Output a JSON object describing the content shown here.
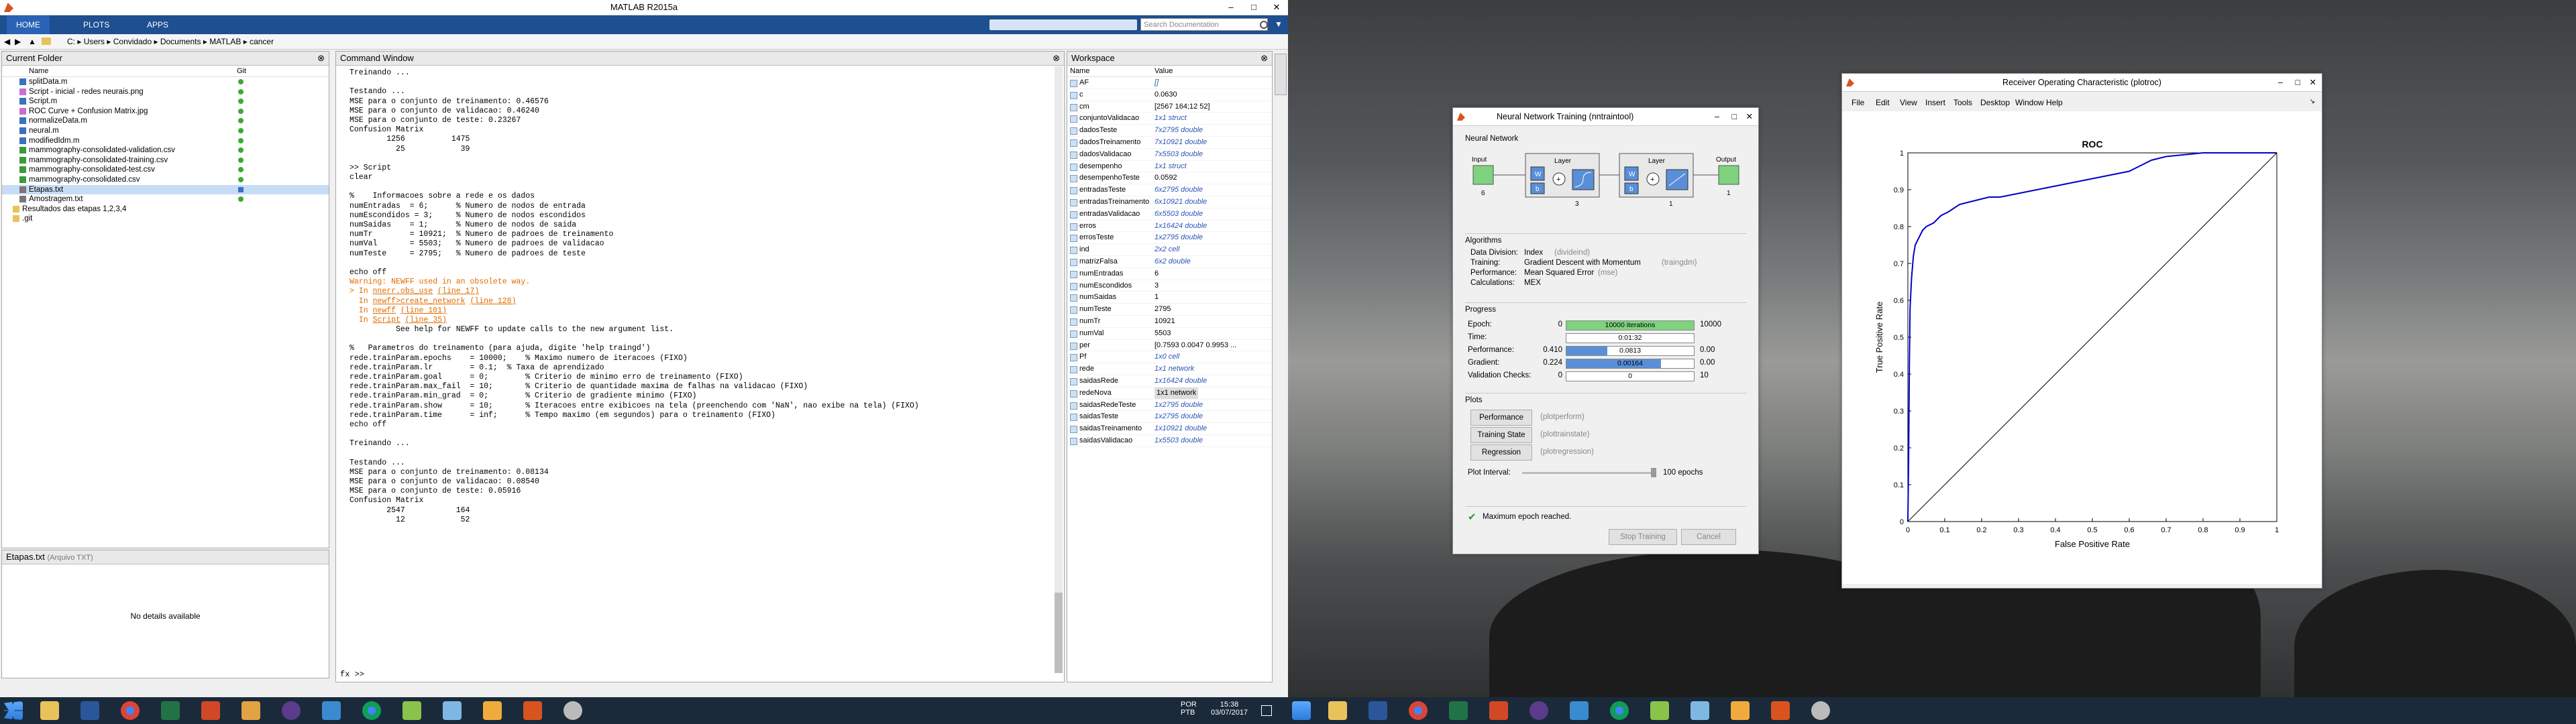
{
  "matlab": {
    "title": "MATLAB R2015a",
    "tabs": [
      "HOME",
      "PLOTS",
      "APPS"
    ],
    "search_placeholder": "Search Documentation",
    "path": [
      "C:",
      "Users",
      "Convidado",
      "Documents",
      "MATLAB",
      "cancer"
    ],
    "current_folder": {
      "title": "Current Folder",
      "col_name": "Name",
      "col_git": "Git",
      "files": [
        {
          "name": "splitData.m",
          "type": "m"
        },
        {
          "name": "Script - inicial - redes neurais.png",
          "type": "png"
        },
        {
          "name": "Script.m",
          "type": "m"
        },
        {
          "name": "ROC Curve + Confusion Matrix.jpg",
          "type": "img"
        },
        {
          "name": "normalizeData.m",
          "type": "m"
        },
        {
          "name": "neural.m",
          "type": "m"
        },
        {
          "name": "modifiedIdm.m",
          "type": "m"
        },
        {
          "name": "mammography-consolidated-validation.csv",
          "type": "csv"
        },
        {
          "name": "mammography-consolidated-training.csv",
          "type": "csv"
        },
        {
          "name": "mammography-consolidated-test.csv",
          "type": "csv"
        },
        {
          "name": "mammography-consolidated.csv",
          "type": "csv"
        },
        {
          "name": "Etapas.txt",
          "type": "txt"
        },
        {
          "name": "Amostragem.txt",
          "type": "txt"
        },
        {
          "name": "Resultados das etapas 1,2,3,4",
          "type": "folder"
        },
        {
          "name": ".git",
          "type": "folder"
        }
      ],
      "details_title": "Etapas.txt",
      "details_subtitle": "(Arquivo TXT)",
      "details_text": "No details available"
    },
    "command_window": {
      "title": "Command Window",
      "prompt": "fx >>",
      "lines": [
        {
          "t": "Treinando ...",
          "c": "n"
        },
        {
          "t": "",
          "c": "n"
        },
        {
          "t": "Testando ...",
          "c": "n"
        },
        {
          "t": "MSE para o conjunto de treinamento: 0.46576",
          "c": "n"
        },
        {
          "t": "MSE para o conjunto de validacao: 0.46240",
          "c": "n"
        },
        {
          "t": "MSE para o conjunto de teste: 0.23267",
          "c": "n"
        },
        {
          "t": "Confusion Matrix",
          "c": "n"
        },
        {
          "t": "        1256          1475",
          "c": "n"
        },
        {
          "t": "          25            39",
          "c": "n"
        },
        {
          "t": "",
          "c": "n"
        },
        {
          "t": ">> Script",
          "c": "n"
        },
        {
          "t": "clear",
          "c": "n"
        },
        {
          "t": "",
          "c": "n"
        },
        {
          "t": "%    Informacoes sobre a rede e os dados",
          "c": "n"
        },
        {
          "t": "numEntradas  = 6;      % Numero de nodos de entrada",
          "c": "n"
        },
        {
          "t": "numEscondidos = 3;     % Numero de nodos escondidos",
          "c": "n"
        },
        {
          "t": "numSaidas    = 1;      % Numero de nodos de saida",
          "c": "n"
        },
        {
          "t": "numTr        = 10921;  % Numero de padroes de treinamento",
          "c": "n"
        },
        {
          "t": "numVal       = 5503;   % Numero de padroes de validacao",
          "c": "n"
        },
        {
          "t": "numTeste     = 2795;   % Numero de padroes de teste",
          "c": "n"
        },
        {
          "t": "",
          "c": "n"
        },
        {
          "t": "echo off",
          "c": "n"
        },
        {
          "t": "Warning: NEWFF used in an obsolete way.",
          "c": "w"
        },
        {
          "t": "> In ",
          "c": "w",
          "l1": "nnerr.obs_use",
          "l2": "(line 17)"
        },
        {
          "t": "  In ",
          "c": "w",
          "l1": "newff>create_network",
          "l2": "(line 128)"
        },
        {
          "t": "  In ",
          "c": "w",
          "l1": "newff",
          "l2": "(line 101)"
        },
        {
          "t": "  In ",
          "c": "w",
          "l1": "Script",
          "l2": "(line 35)"
        },
        {
          "t": "          See help for NEWFF to update calls to the new argument list.",
          "c": "n"
        },
        {
          "t": "",
          "c": "n"
        },
        {
          "t": "%   Parametros do treinamento (para ajuda, digite 'help traingd')",
          "c": "n"
        },
        {
          "t": "rede.trainParam.epochs    = 10000;    % Maximo numero de iteracoes (FIXO)",
          "c": "n"
        },
        {
          "t": "rede.trainParam.lr        = 0.1;  % Taxa de aprendizado",
          "c": "n"
        },
        {
          "t": "rede.trainParam.goal      = 0;        % Criterio de minimo erro de treinamento (FIXO)",
          "c": "n"
        },
        {
          "t": "rede.trainParam.max_fail  = 10;       % Criterio de quantidade maxima de falhas na validacao (FIXO)",
          "c": "n"
        },
        {
          "t": "rede.trainParam.min_grad  = 0;        % Criterio de gradiente minimo (FIXO)",
          "c": "n"
        },
        {
          "t": "rede.trainParam.show      = 10;       % Iteracoes entre exibicoes na tela (preenchendo com 'NaN', nao exibe na tela) (FIXO)",
          "c": "n"
        },
        {
          "t": "rede.trainParam.time      = inf;      % Tempo maximo (em segundos) para o treinamento (FIXO)",
          "c": "n"
        },
        {
          "t": "echo off",
          "c": "n"
        },
        {
          "t": "",
          "c": "n"
        },
        {
          "t": "Treinando ...",
          "c": "n"
        },
        {
          "t": "",
          "c": "n"
        },
        {
          "t": "Testando ...",
          "c": "n"
        },
        {
          "t": "MSE para o conjunto de treinamento: 0.08134",
          "c": "n"
        },
        {
          "t": "MSE para o conjunto de validacao: 0.08540",
          "c": "n"
        },
        {
          "t": "MSE para o conjunto de teste: 0.05916",
          "c": "n"
        },
        {
          "t": "Confusion Matrix",
          "c": "n"
        },
        {
          "t": "        2547           164",
          "c": "n"
        },
        {
          "t": "          12            52",
          "c": "n"
        }
      ]
    },
    "workspace": {
      "title": "Workspace",
      "col_name": "Name",
      "col_value": "Value",
      "vars": [
        {
          "n": "AF",
          "v": "[]",
          "b": true
        },
        {
          "n": "c",
          "v": "0.0630",
          "b": false
        },
        {
          "n": "cm",
          "v": "[2567 164;12 52]",
          "b": false
        },
        {
          "n": "conjuntoValidacao",
          "v": "1x1 struct",
          "b": true
        },
        {
          "n": "dadosTeste",
          "v": "7x2795 double",
          "b": true
        },
        {
          "n": "dadosTreinamento",
          "v": "7x10921 double",
          "b": true
        },
        {
          "n": "dadosValidacao",
          "v": "7x5503 double",
          "b": true
        },
        {
          "n": "desempenho",
          "v": "1x1 struct",
          "b": true
        },
        {
          "n": "desempenhoTeste",
          "v": "0.0592",
          "b": false
        },
        {
          "n": "entradasTeste",
          "v": "6x2795 double",
          "b": true
        },
        {
          "n": "entradasTreinamento",
          "v": "6x10921 double",
          "b": true
        },
        {
          "n": "entradasValidacao",
          "v": "6x5503 double",
          "b": true
        },
        {
          "n": "erros",
          "v": "1x16424 double",
          "b": true
        },
        {
          "n": "errosTeste",
          "v": "1x2795 double",
          "b": true
        },
        {
          "n": "ind",
          "v": "2x2 cell",
          "b": true
        },
        {
          "n": "matrizFalsa",
          "v": "6x2 double",
          "b": true
        },
        {
          "n": "numEntradas",
          "v": "6",
          "b": false
        },
        {
          "n": "numEscondidos",
          "v": "3",
          "b": false
        },
        {
          "n": "numSaidas",
          "v": "1",
          "b": false
        },
        {
          "n": "numTeste",
          "v": "2795",
          "b": false
        },
        {
          "n": "numTr",
          "v": "10921",
          "b": false
        },
        {
          "n": "numVal",
          "v": "5503",
          "b": false
        },
        {
          "n": "per",
          "v": "[0.7593 0.0047 0.9953 ...",
          "b": false
        },
        {
          "n": "Pf",
          "v": "1x0 cell",
          "b": true
        },
        {
          "n": "rede",
          "v": "1x1 network",
          "b": true
        },
        {
          "n": "saidasRede",
          "v": "1x16424 double",
          "b": true
        },
        {
          "n": "redeNova",
          "v": "1x1 network",
          "b": false,
          "sel": true
        },
        {
          "n": "saidasRedeTeste",
          "v": "1x2795 double",
          "b": true
        },
        {
          "n": "saidasTeste",
          "v": "1x2795 double",
          "b": true
        },
        {
          "n": "saidasTreinamento",
          "v": "1x10921 double",
          "b": true
        },
        {
          "n": "saidasValidacao",
          "v": "1x5503 double",
          "b": true
        }
      ]
    }
  },
  "nntraintool": {
    "title": "Neural Network Training (nntraintool)",
    "sec_network": "Neural Network",
    "net_labels": {
      "input": "Input",
      "layer1": "Layer",
      "layer2": "Layer",
      "output": "Output",
      "n_in": "6",
      "n_h": "3",
      "n_o": "1",
      "n_out": "1",
      "w": "W",
      "b": "b"
    },
    "sec_algorithms": "Algorithms",
    "algorithms": [
      {
        "k": "Data Division:",
        "v": "Index",
        "x": "(divideind)"
      },
      {
        "k": "Training:",
        "v": "Gradient Descent with Momentum",
        "x": "(traingdm)"
      },
      {
        "k": "Performance:",
        "v": "Mean Squared Error",
        "x": "(mse)"
      },
      {
        "k": "Calculations:",
        "v": "MEX",
        "x": ""
      }
    ],
    "sec_progress": "Progress",
    "progress": [
      {
        "k": "Epoch:",
        "l": "0",
        "bar": "10000 iterations",
        "r": "10000",
        "fill": 1.0,
        "color": "#7fd37f"
      },
      {
        "k": "Time:",
        "l": "",
        "bar": "0:01:32",
        "r": "",
        "fill": 0,
        "color": "#ffffff"
      },
      {
        "k": "Performance:",
        "l": "0.410",
        "bar": "0.0813",
        "r": "0.00",
        "fill": 0.32,
        "color": "#5a8fd8"
      },
      {
        "k": "Gradient:",
        "l": "0.224",
        "bar": "0.00164",
        "r": "0.00",
        "fill": 0.74,
        "color": "#5a8fd8"
      },
      {
        "k": "Validation Checks:",
        "l": "0",
        "bar": "0",
        "r": "10",
        "fill": 0,
        "color": "#ffffff"
      }
    ],
    "sec_plots": "Plots",
    "plots": [
      {
        "b": "Performance",
        "x": "(plotperform)"
      },
      {
        "b": "Training State",
        "x": "(plottrainstate)"
      },
      {
        "b": "Regression",
        "x": "(plotregression)"
      }
    ],
    "plot_interval_label": "Plot Interval:",
    "plot_interval_value": "100 epochs",
    "status": "Maximum epoch reached.",
    "stop_button": "Stop Training",
    "cancel_button": "Cancel"
  },
  "roc_window": {
    "title": "Receiver Operating Characteristic (plotroc)",
    "menu": [
      "File",
      "Edit",
      "View",
      "Insert",
      "Tools",
      "Desktop",
      "Window",
      "Help"
    ]
  },
  "chart_data": {
    "type": "line",
    "title": "ROC",
    "xlabel": "False Positive Rate",
    "ylabel": "True Positive Rate",
    "xlim": [
      0,
      1
    ],
    "ylim": [
      0,
      1
    ],
    "xticks": [
      "0",
      "0.1",
      "0.2",
      "0.3",
      "0.4",
      "0.5",
      "0.6",
      "0.7",
      "0.8",
      "0.9",
      "1"
    ],
    "yticks": [
      "0",
      "0.1",
      "0.2",
      "0.3",
      "0.4",
      "0.5",
      "0.6",
      "0.7",
      "0.8",
      "0.9",
      "1"
    ],
    "series": [
      {
        "color": "#0000cc",
        "x": [
          0,
          0.002,
          0.004,
          0.006,
          0.01,
          0.015,
          0.02,
          0.03,
          0.04,
          0.05,
          0.07,
          0.09,
          0.11,
          0.14,
          0.18,
          0.22,
          0.25,
          0.3,
          0.35,
          0.4,
          0.45,
          0.5,
          0.55,
          0.6,
          0.62,
          0.64,
          0.66,
          0.7,
          0.8,
          0.9,
          1
        ],
        "y": [
          0,
          0.16,
          0.42,
          0.58,
          0.66,
          0.72,
          0.75,
          0.77,
          0.79,
          0.8,
          0.81,
          0.83,
          0.84,
          0.86,
          0.87,
          0.88,
          0.88,
          0.89,
          0.9,
          0.91,
          0.92,
          0.93,
          0.94,
          0.95,
          0.96,
          0.97,
          0.98,
          0.99,
          1,
          1,
          1
        ]
      },
      {
        "color": "#000000",
        "x": [
          0,
          1
        ],
        "y": [
          0,
          1
        ]
      }
    ],
    "grid": false
  },
  "taskbar": {
    "lang": "POR",
    "layout": "PTB",
    "time": "15:38",
    "date": "03/07/2017"
  }
}
